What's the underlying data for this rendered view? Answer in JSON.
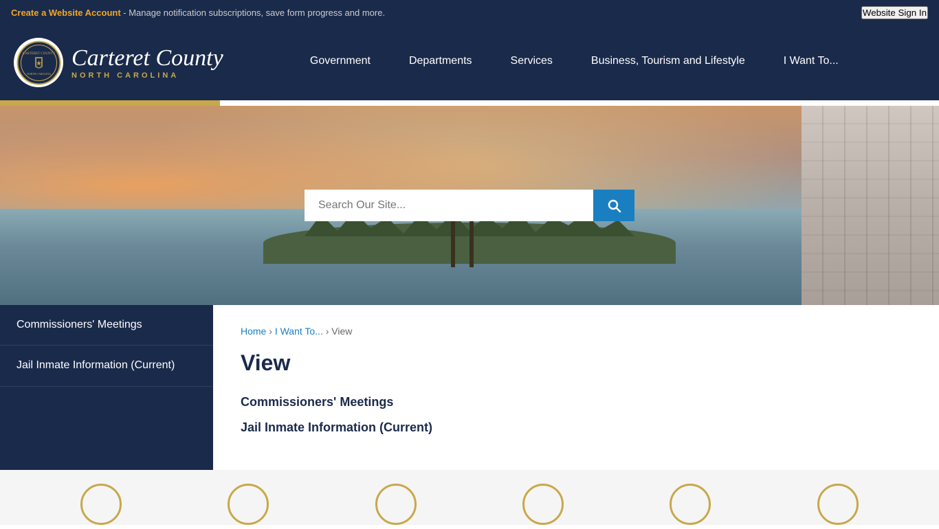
{
  "topbar": {
    "link_text": "Create a Website Account",
    "description": " - Manage notification subscriptions, save form progress and more.",
    "signin_label": "Website Sign In"
  },
  "header": {
    "county_name_main": "Carteret County",
    "county_name_sub": "NORTH CAROLINA",
    "nav_items": [
      {
        "id": "government",
        "label": "Government"
      },
      {
        "id": "departments",
        "label": "Departments"
      },
      {
        "id": "services",
        "label": "Services"
      },
      {
        "id": "business",
        "label": "Business, Tourism and Lifestyle"
      },
      {
        "id": "iwantto",
        "label": "I Want To..."
      }
    ]
  },
  "search": {
    "placeholder": "Search Our Site..."
  },
  "sidebar": {
    "items": [
      {
        "id": "commissioners",
        "label": "Commissioners' Meetings"
      },
      {
        "id": "jail",
        "label": "Jail Inmate Information (Current)"
      }
    ]
  },
  "breadcrumb": {
    "home": "Home",
    "separator1": " › ",
    "iwantto": "I Want To...",
    "separator2": " › ",
    "current": "View"
  },
  "main": {
    "page_title": "View",
    "links": [
      {
        "id": "commissioners-link",
        "label": "Commissioners' Meetings"
      },
      {
        "id": "jail-link",
        "label": "Jail Inmate Information (Current)"
      }
    ]
  },
  "bottom_circles": {
    "count": 6
  }
}
